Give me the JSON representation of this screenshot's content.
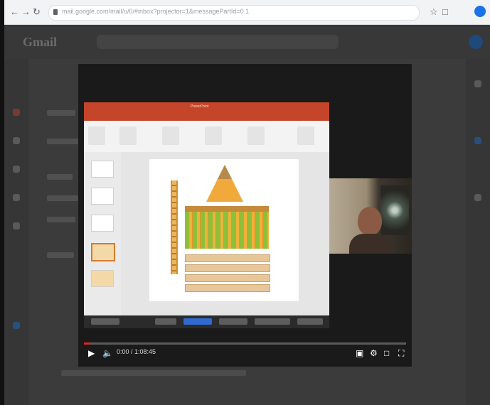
{
  "browser": {
    "url": "mail.google.com/mail/u/0/#inbox?projector=1&messagePartId=0.1"
  },
  "gmail": {
    "logo": "Gmail"
  },
  "player": {
    "time": "0:00 / 1:08:45",
    "progress": 0.02,
    "presentation_title": "PowerPoint"
  },
  "colors": {
    "progress": "#e02424",
    "ppt_red": "#c4452a",
    "pyramid": "#f2a93b"
  }
}
